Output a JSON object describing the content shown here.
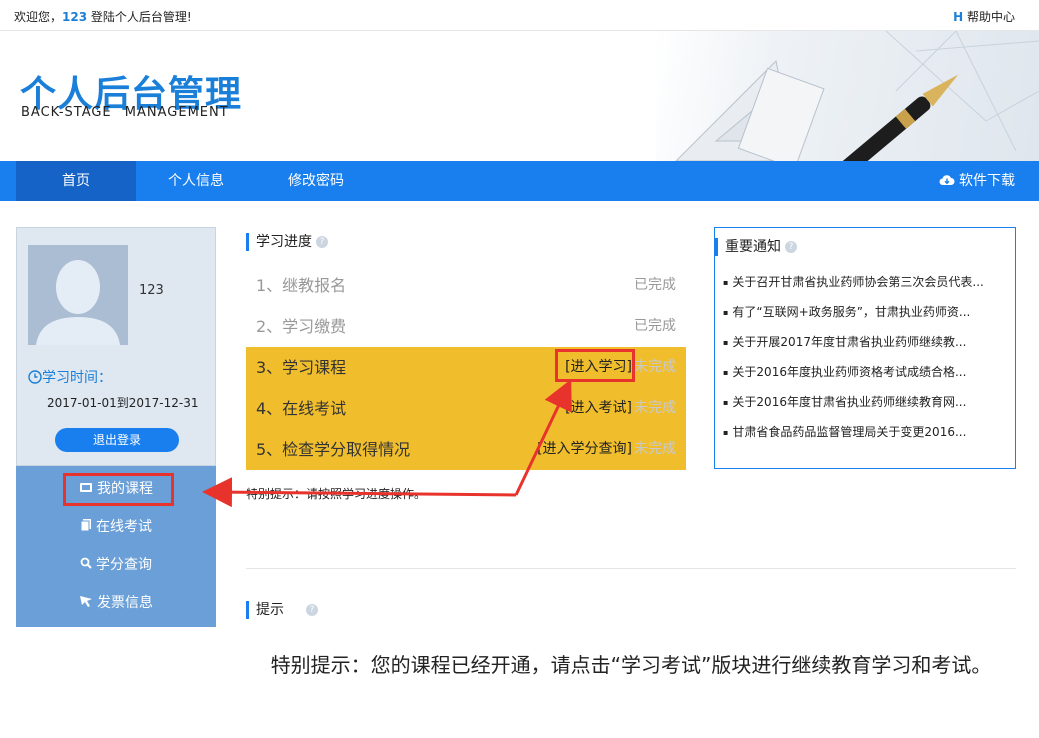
{
  "topbar": {
    "welcome_prefix": "欢迎您，",
    "user_id": "123",
    "welcome_suffix": " 登陆个人后台管理!",
    "help_icon": "H",
    "help_label": "帮助中心"
  },
  "header": {
    "title_cn": "个人后台管理",
    "title_en": "BACK-STAGE MANAGEMENT"
  },
  "nav": {
    "items": [
      {
        "label": "首页"
      },
      {
        "label": "个人信息"
      },
      {
        "label": "修改密码"
      }
    ],
    "download_label": "软件下载"
  },
  "profile": {
    "username": "123",
    "study_time_label": "学习时间：",
    "date_range": "2017-01-01到2017-12-31",
    "logout_label": "退出登录"
  },
  "menu": {
    "items": [
      {
        "label": "我的课程",
        "icon": "tv-icon"
      },
      {
        "label": "在线考试",
        "icon": "exam-icon"
      },
      {
        "label": "学分查询",
        "icon": "search-icon"
      },
      {
        "label": "发票信息",
        "icon": "invoice-icon"
      }
    ]
  },
  "progress": {
    "title": "学习进度",
    "steps": [
      {
        "label": "1、继教报名",
        "action": "",
        "status": "已完成"
      },
      {
        "label": "2、学习缴费",
        "action": "",
        "status": "已完成"
      },
      {
        "label": "3、学习课程",
        "action": "[进入学习]",
        "status": "未完成"
      },
      {
        "label": "4、在线考试",
        "action": "[进入考试]",
        "status": "未完成"
      },
      {
        "label": "5、检查学分取得情况",
        "action": "[进入学分查询]",
        "status": "未完成"
      }
    ],
    "hint": "特别提示：请按照学习进度操作。"
  },
  "notice": {
    "title": "重要通知",
    "items": [
      "关于召开甘肃省执业药师协会第三次会员代表...",
      "有了“互联网+政务服务”，甘肃执业药师资...",
      "关于开展2017年度甘肃省执业药师继续教...",
      "关于2016年度执业药师资格考试成绩合格...",
      "关于2016年度甘肃省执业药师继续教育网...",
      "甘肃省食品药品监督管理局关于变更2016..."
    ]
  },
  "tip": {
    "title": "提示",
    "body": "特别提示：您的课程已经开通，请点击“学习考试”版块进行继续教育学习和考试。"
  },
  "colors": {
    "accent": "#1a7fee",
    "highlight": "#e8332d",
    "pending_row": "#f0be2c"
  }
}
